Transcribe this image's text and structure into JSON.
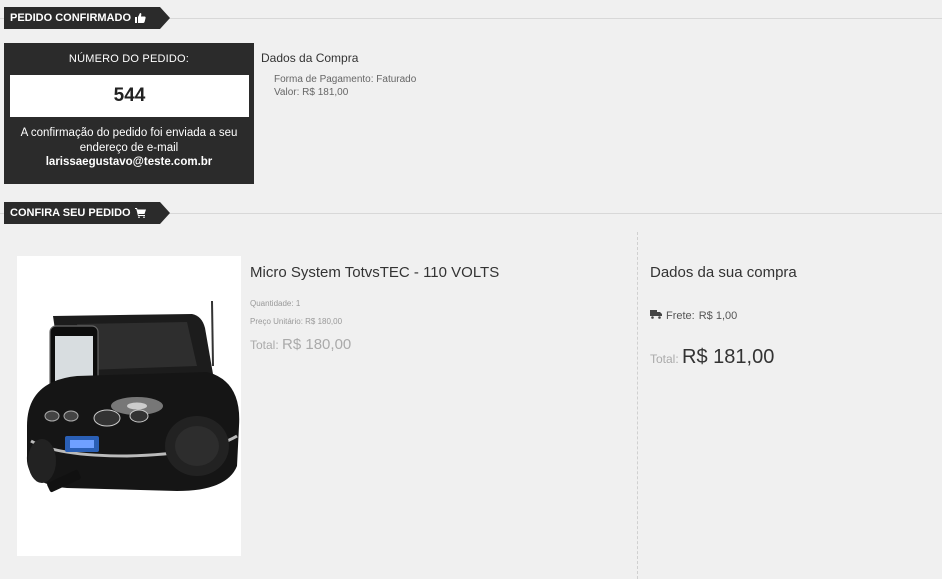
{
  "sections": {
    "confirmed_label": "PEDIDO CONFIRMADO",
    "review_label": "CONFIRA SEU PEDIDO"
  },
  "order": {
    "number_label": "NÚMERO DO PEDIDO:",
    "number": "544",
    "confirmation_message": "A confirmação do pedido foi enviada a seu endereço de e-mail",
    "email": "larissaegustavo@teste.com.br"
  },
  "purchase_summary": {
    "title": "Dados da Compra",
    "payment": "Forma de Pagamento: Faturado",
    "value": "Valor: R$ 181,00"
  },
  "product": {
    "name": "Micro System TotvsTEC - 110 VOLTS",
    "quantity": "Quantidade: 1",
    "unit_price": "Preço Unitário: R$ 180,00",
    "total_label": "Total:",
    "total_value": "R$ 180,00"
  },
  "order_data": {
    "title": "Dados da sua compra",
    "freight_label": "Frete:",
    "freight_value": "R$ 1,00",
    "total_label": "Total:",
    "total_value": "R$ 181,00"
  },
  "icons": {
    "confirmed": "thumbs-up-icon",
    "review": "cart-icon",
    "freight": "truck-icon"
  },
  "colors": {
    "dark": "#2b2b2b",
    "background": "#f0f0f0"
  }
}
